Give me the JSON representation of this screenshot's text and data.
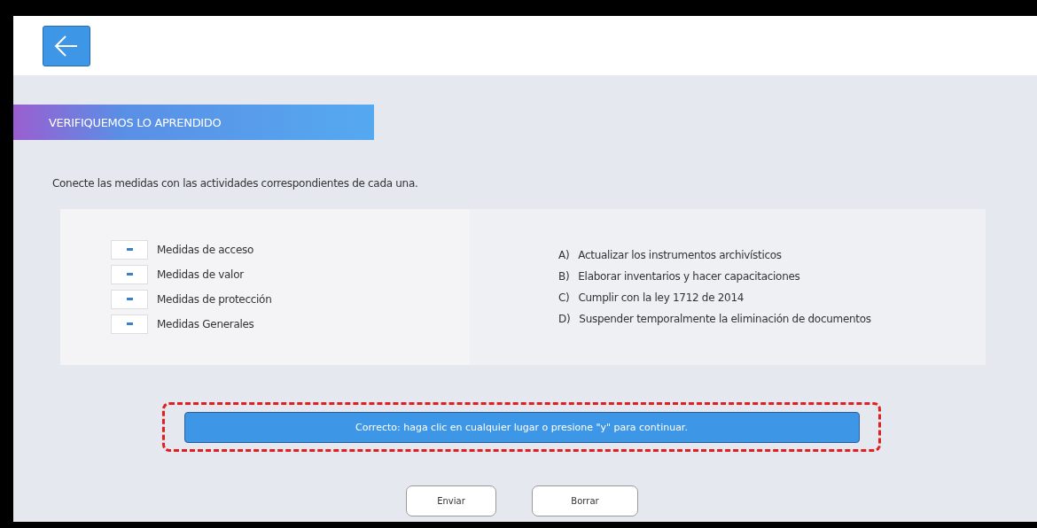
{
  "header": {
    "back_button": true
  },
  "banner": {
    "title": "VERIFIQUEMOS LO APRENDIDO"
  },
  "instruction": "Conecte las medidas con las actividades correspondientes de cada una.",
  "measures": [
    {
      "label": "Medidas de acceso"
    },
    {
      "label": "Medidas de valor"
    },
    {
      "label": "Medidas de protección"
    },
    {
      "label": "Medidas Generales"
    }
  ],
  "activities": [
    {
      "letter": "A)",
      "text": "Actualizar los instrumentos archivísticos"
    },
    {
      "letter": "B)",
      "text": "Elaborar inventarios y hacer capacitaciones"
    },
    {
      "letter": "C)",
      "text": "Cumplir con la ley 1712 de 2014"
    },
    {
      "letter": "D)",
      "text": "Suspender temporalmente la eliminación de documentos"
    }
  ],
  "feedback": {
    "text": "Correcto: haga clic en cualquier lugar o presione \"y\" para continuar.",
    "highlighted": true
  },
  "buttons": [
    "Enviar",
    "Borrar"
  ]
}
